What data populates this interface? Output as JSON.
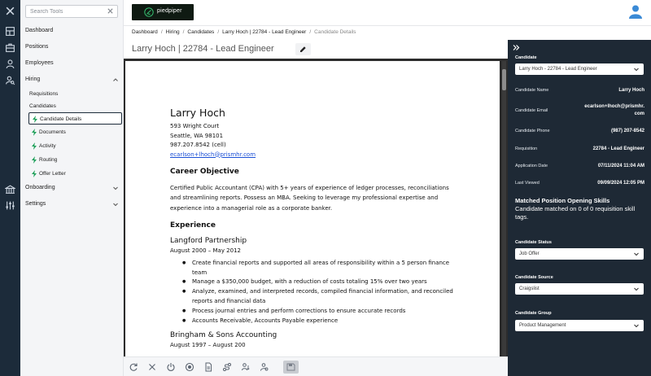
{
  "sidebar": {
    "search_placeholder": "Search Tools",
    "dashboard": "Dashboard",
    "positions": "Positions",
    "employees": "Employees",
    "hiring": "Hiring",
    "requisitions": "Requisitions",
    "candidates": "Candidates",
    "items": [
      "Candidate Details",
      "Documents",
      "Activity",
      "Routing",
      "Offer Letter"
    ],
    "onboarding": "Onboarding",
    "settings": "Settings"
  },
  "header": {
    "logo_text": "piedpiper"
  },
  "breadcrumb": [
    "Dashboard",
    "Hiring",
    "Candidates",
    "Larry Hoch | 22784 - Lead Engineer",
    "Candidate Details"
  ],
  "page_title": "Larry Hoch | 22784 - Lead Engineer",
  "resume": {
    "name": "Larry Hoch",
    "address1": "593 Wright Court",
    "address2": "Seattle, WA 98101",
    "phone": "987.207.8542 (cell)",
    "email": "ecarlson+lhoch@prismhr.com",
    "objective_heading": "Career Objective",
    "objective": "Certified Public Accountant (CPA) with 5+ years of experience of ledger processes, reconciliations and streamlining reports. Possess an MBA. Seeking to leverage my professional expertise and experience into a managerial role as a corporate banker.",
    "experience_heading": "Experience",
    "jobs": [
      {
        "org": "Langford Partnership",
        "dates": "August 2000 – May 2012",
        "bullets": [
          "Create financial reports and supported all areas of responsibility within a 5 person finance team",
          "Manage a $350,000 budget, with a reduction of costs totaling 15% over two years",
          "Analyze, examined, and interpreted records, compiled financial information, and reconciled reports and financial data",
          "Process journal entries and perform corrections to ensure accurate records",
          "Accounts Receivable, Accounts Payable experience"
        ]
      },
      {
        "org": "Bringham & Sons Accounting",
        "dates": "August 1997 – August 200"
      }
    ]
  },
  "panel": {
    "candidate_label": "Candidate",
    "candidate_select": "Larry Hoch - 22784 - Lead Engineer",
    "fields": {
      "name_key": "Candidate Name",
      "name_val": "Larry Hoch",
      "email_key": "Candidate Email",
      "email_val_1": "ecarlson+lhoch@prismhr.",
      "email_val_2": "com",
      "phone_key": "Candidate Phone",
      "phone_val": "(987) 207-8542",
      "req_key": "Requisition",
      "req_val": "22784 - Lead Engineer",
      "app_key": "Application Date",
      "app_val": "07/11/2024 11:04 AM",
      "viewed_key": "Last Viewed",
      "viewed_val": "09/09/2024 12:05 PM"
    },
    "skills_heading": "Matched Position Opening Skills",
    "skills_note": "Candidate matched on 0 of 0 requisition skill tags.",
    "status_label": "Candidate Status",
    "status_value": "Job Offer",
    "source_label": "Candidate Source",
    "source_value": "Craigslist",
    "group_label": "Candidate Group",
    "group_value": "Product Management"
  }
}
